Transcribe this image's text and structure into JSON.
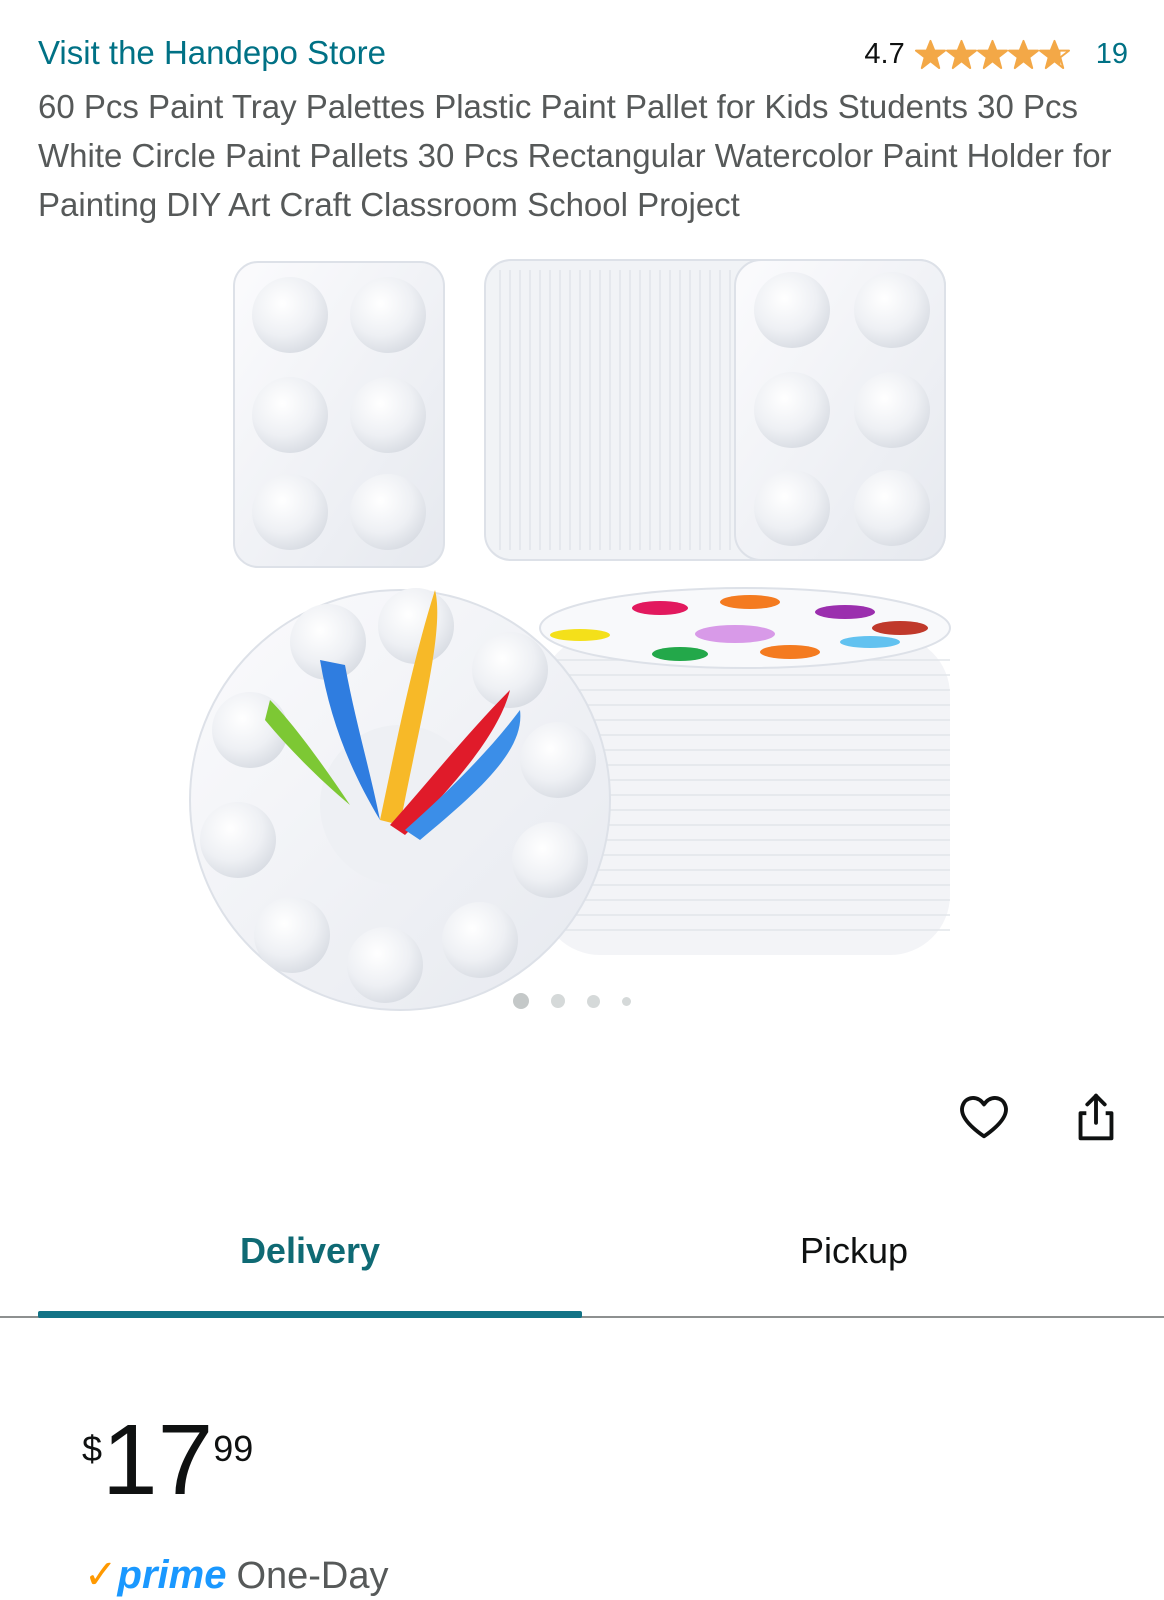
{
  "store": {
    "link_text": "Visit the Handepo Store"
  },
  "rating": {
    "value": "4.7",
    "stars": 4.7,
    "count": "19",
    "star_color": "#f3a847"
  },
  "product": {
    "title": "60 Pcs Paint Tray Palettes Plastic Paint Pallet for Kids Students 30 Pcs White Circle Paint Pallets 30 Pcs Rectangular Watercolor Paint Holder for Painting DIY Art Craft Classroom School Project"
  },
  "gallery": {
    "image_count": 4,
    "active_index": 0
  },
  "actions": {
    "favorite_icon": "heart-icon",
    "share_icon": "share-icon"
  },
  "tabs": [
    {
      "label": "Delivery",
      "active": true
    },
    {
      "label": "Pickup",
      "active": false
    }
  ],
  "price": {
    "symbol": "$",
    "whole": "17",
    "fraction": "99"
  },
  "prime": {
    "check": "✓",
    "brand": "prime",
    "text": "One-Day"
  },
  "colors": {
    "link": "#007185",
    "active_tab": "#127386",
    "prime_blue": "#1a98ff",
    "prime_check": "#ff9900"
  }
}
